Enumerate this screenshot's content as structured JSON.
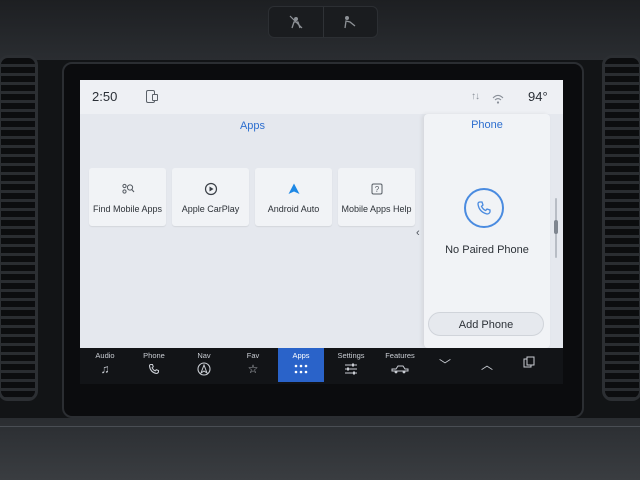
{
  "statusbar": {
    "time": "2:50",
    "temperature": "94°"
  },
  "apps": {
    "title": "Apps",
    "tiles": [
      {
        "label": "Find Mobile Apps",
        "icon": "find-apps-icon"
      },
      {
        "label": "Apple CarPlay",
        "icon": "carplay-icon"
      },
      {
        "label": "Android Auto",
        "icon": "android-auto-icon"
      },
      {
        "label": "Mobile Apps Help",
        "icon": "help-icon"
      }
    ]
  },
  "phone_panel": {
    "title": "Phone",
    "status": "No Paired Phone",
    "add_button": "Add Phone"
  },
  "navbar": {
    "items": [
      {
        "label": "Audio",
        "icon": "music-note-icon"
      },
      {
        "label": "Phone",
        "icon": "phone-icon"
      },
      {
        "label": "Nav",
        "icon": "navigation-icon"
      },
      {
        "label": "Fav",
        "icon": "star-icon"
      },
      {
        "label": "Apps",
        "icon": "apps-grid-icon",
        "active": true
      },
      {
        "label": "Settings",
        "icon": "sliders-icon"
      },
      {
        "label": "Features",
        "icon": "vehicle-icon"
      }
    ]
  },
  "colors": {
    "accent": "#2e6fcf",
    "active_tab": "#2a63c9",
    "screen_bg": "#e5e8ee",
    "android_auto": "#1e88e5"
  }
}
